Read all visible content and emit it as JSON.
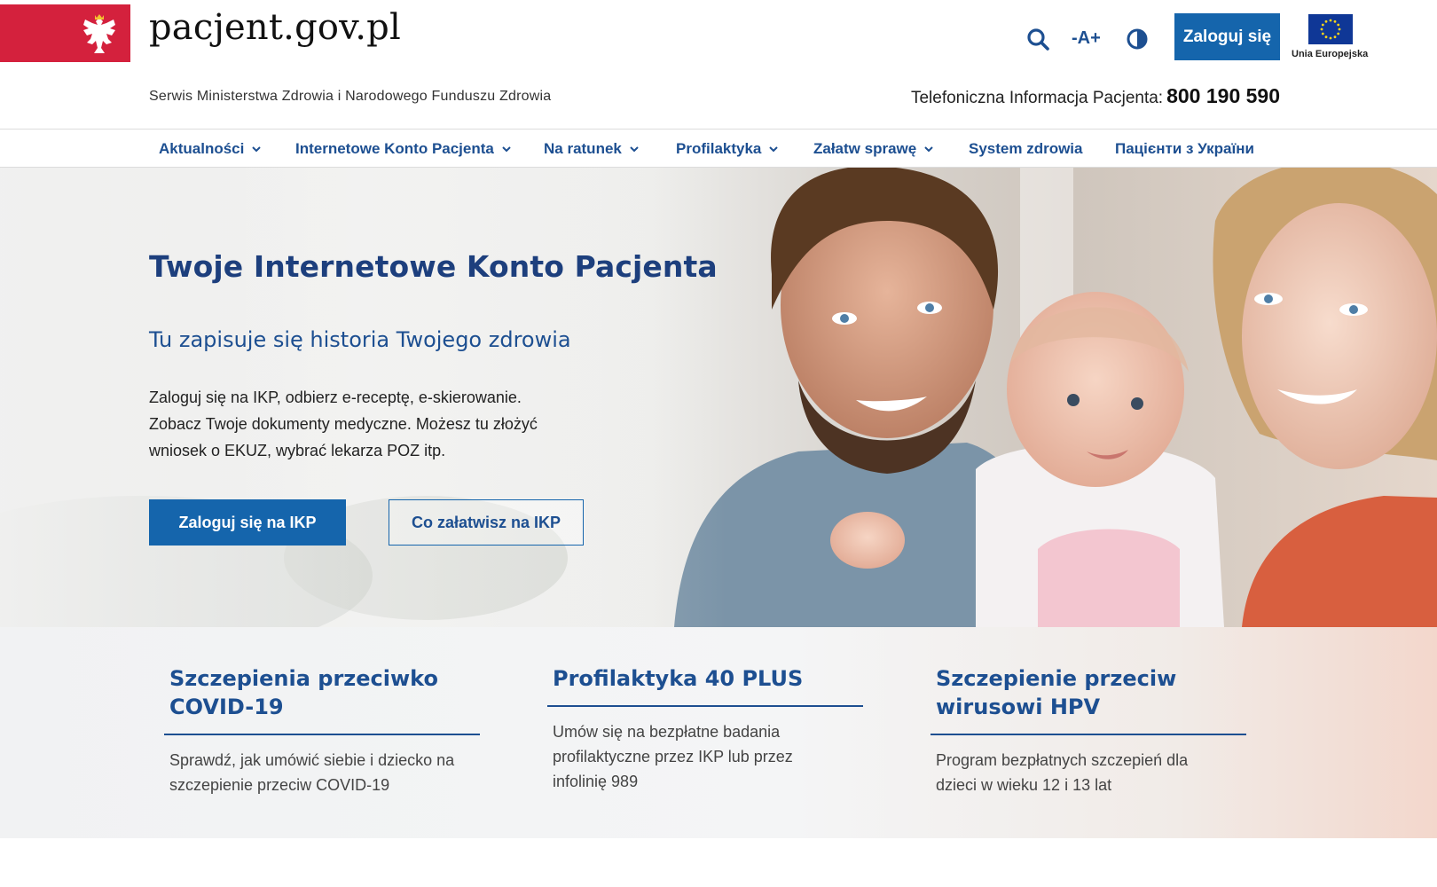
{
  "header": {
    "logo_text": "pacjent.gov.pl",
    "subtitle": "Serwis Ministerstwa Zdrowia i Narodowego Funduszu Zdrowia",
    "font_size_toggle": "-A+",
    "login_label": "Zaloguj się",
    "eu_label": "Unia Europejska",
    "hotline_label": "Telefoniczna Informacja Pacjenta:",
    "hotline_number": "800 190 590",
    "icons": [
      "emblem-eagle-icon",
      "search-icon",
      "contrast-icon",
      "eu-flag-icon"
    ]
  },
  "nav": {
    "items": [
      {
        "label": "Aktualności",
        "has_dropdown": true
      },
      {
        "label": "Internetowe Konto Pacjenta",
        "has_dropdown": true
      },
      {
        "label": "Na ratunek",
        "has_dropdown": true
      },
      {
        "label": "Profilaktyka",
        "has_dropdown": true
      },
      {
        "label": "Załatw sprawę",
        "has_dropdown": true
      },
      {
        "label": "System zdrowia",
        "has_dropdown": false
      },
      {
        "label": "Пацієнти з України",
        "has_dropdown": false
      }
    ]
  },
  "hero": {
    "title": "Twoje Internetowe Konto Pacjenta",
    "subtitle": "Tu zapisuje się historia Twojego zdrowia",
    "description_lines": [
      "Zaloguj się na IKP, odbierz e-receptę, e-skierowanie.",
      "Zobacz Twoje dokumenty medyczne. Możesz tu złożyć",
      "wniosek o EKUZ, wybrać lekarza POZ itp."
    ],
    "primary_button": "Zaloguj się na IKP",
    "secondary_button": "Co załatwisz na IKP"
  },
  "features": [
    {
      "title_lines": [
        "Szczepienia przeciwko",
        "COVID-19"
      ],
      "text_lines": [
        "Sprawdź, jak umówić siebie i dziecko na",
        "szczepienie przeciw COVID-19"
      ]
    },
    {
      "title_lines": [
        "Profilaktyka 40 PLUS"
      ],
      "text_lines": [
        "Umów się na bezpłatne badania",
        "profilaktyczne przez IKP lub przez",
        "infolinię 989"
      ]
    },
    {
      "title_lines": [
        "Szczepienie przeciw",
        "wirusowi HPV"
      ],
      "text_lines": [
        "Program bezpłatnych szczepień dla",
        "dzieci w wieku 12 i 13 lat"
      ]
    }
  ],
  "colors": {
    "brand_blue": "#1565ac",
    "nav_text": "#1d4f91",
    "emblem_red": "#d4213d",
    "eu_blue": "#0f3796"
  }
}
